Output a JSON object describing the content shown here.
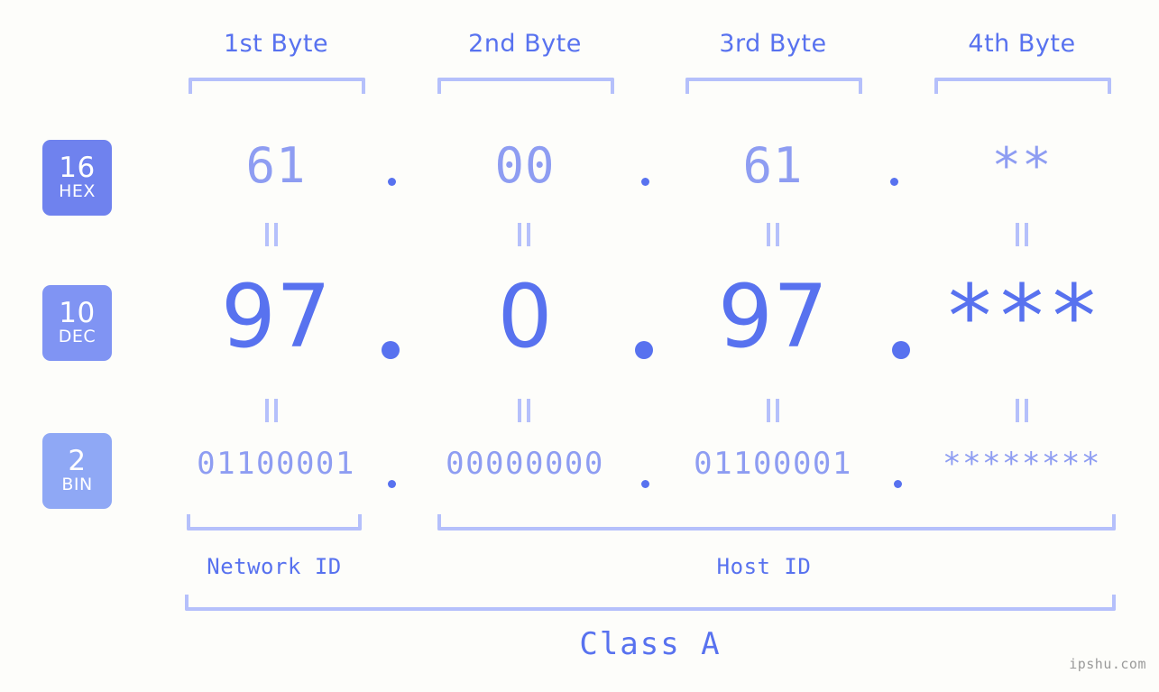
{
  "meta": {
    "watermark": "ipshu.com"
  },
  "colors": {
    "background": "#fdfdfa",
    "accent_strong": "#5872ef",
    "accent_light": "#8e9df2",
    "bracket": "#b5c0fb",
    "badge_hex": "#6f82ee",
    "badge_dec": "#8094f3",
    "badge_bin": "#8fa8f5",
    "watermark_text": "#9a9a9a"
  },
  "byte_headers": [
    {
      "label": "1st Byte"
    },
    {
      "label": "2nd Byte"
    },
    {
      "label": "3rd Byte"
    },
    {
      "label": "4th Byte"
    }
  ],
  "bases": [
    {
      "key": "hex",
      "num": "16",
      "sub": "HEX"
    },
    {
      "key": "dec",
      "num": "10",
      "sub": "DEC"
    },
    {
      "key": "bin",
      "num": "2",
      "sub": "BIN"
    }
  ],
  "rows": {
    "hex": {
      "num": "16",
      "sub": "HEX",
      "bytes": [
        "61",
        "00",
        "61",
        "**"
      ],
      "separator": "."
    },
    "dec": {
      "num": "10",
      "sub": "DEC",
      "bytes": [
        "97",
        "0",
        "97",
        "***"
      ],
      "separator": "."
    },
    "bin": {
      "num": "2",
      "sub": "BIN",
      "bytes": [
        "01100001",
        "00000000",
        "01100001",
        "********"
      ],
      "separator": "."
    }
  },
  "equals_marks": {
    "symbol": "=",
    "count_per_gap": 4,
    "gaps": [
      "hex-to-dec",
      "dec-to-bin"
    ]
  },
  "sections": {
    "network_id": {
      "label": "Network ID",
      "spans_bytes": "1"
    },
    "host_id": {
      "label": "Host ID",
      "spans_bytes": "2-4"
    },
    "class": {
      "label": "Class A",
      "spans_bytes": "1-4"
    }
  }
}
